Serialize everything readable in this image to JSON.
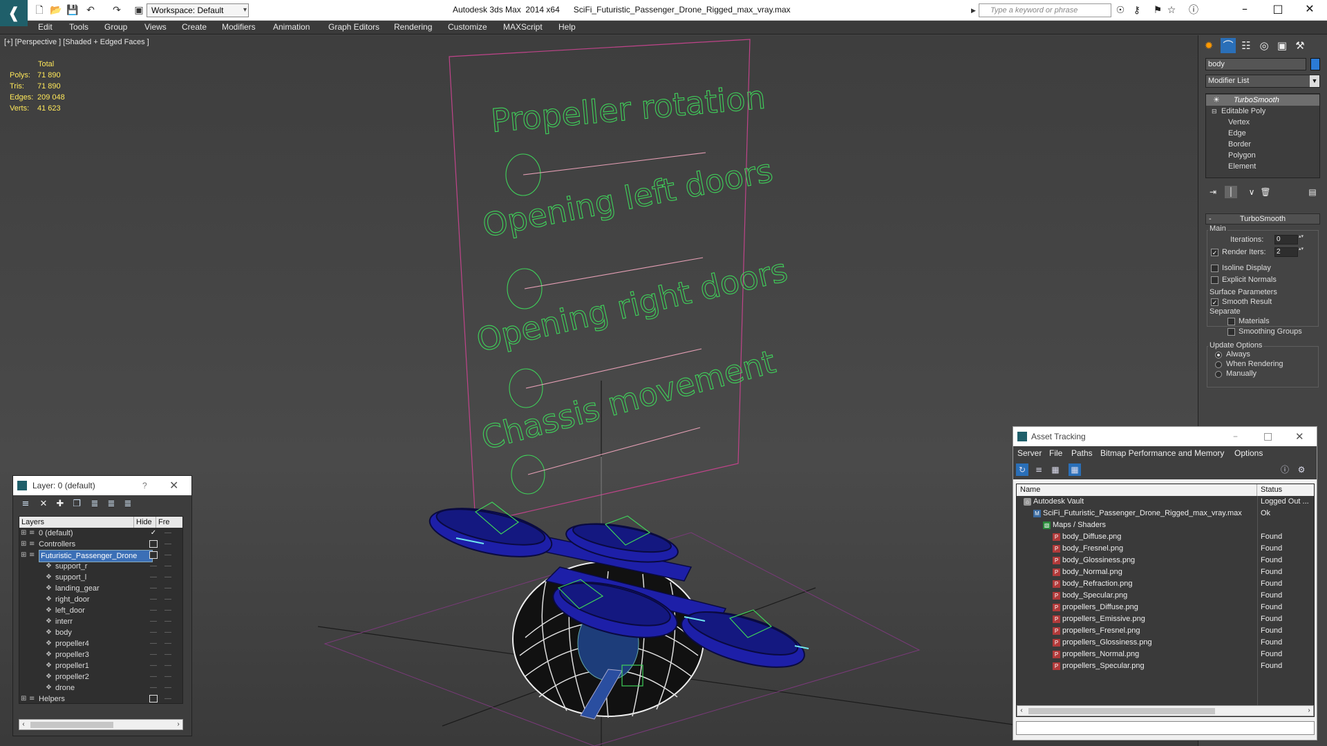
{
  "titlebar": {
    "workspace": "Workspace: Default",
    "title": "Autodesk 3ds Max  2014 x64      SciFi_Futuristic_Passenger_Drone_Rigged_max_vray.max",
    "search_placeholder": "Type a keyword or phrase"
  },
  "menu": [
    "Edit",
    "Tools",
    "Group",
    "Views",
    "Create",
    "Modifiers",
    "Animation",
    "Graph Editors",
    "Rendering",
    "Customize",
    "MAXScript",
    "Help"
  ],
  "viewport": {
    "label": "[+] [Perspective ] [Shaded + Edged Faces ]",
    "stats": {
      "header": "Total",
      "rows": [
        {
          "label": "Polys:",
          "value": "71 890"
        },
        {
          "label": "Tris:",
          "value": "71 890"
        },
        {
          "label": "Edges:",
          "value": "209 048"
        },
        {
          "label": "Verts:",
          "value": "41 623"
        }
      ]
    },
    "controls": [
      "Propeller rotation",
      "Opening left doors",
      "Opening right doors",
      "Chassis movement"
    ]
  },
  "layer_window": {
    "title": "Layer: 0 (default)",
    "help": "?",
    "columns": [
      "Layers",
      "Hide",
      "Fre"
    ],
    "rows": [
      {
        "name": "0 (default)",
        "indent": 0,
        "kind": "layer",
        "hide": "check"
      },
      {
        "name": "Controllers",
        "indent": 0,
        "kind": "layer",
        "hide": "box"
      },
      {
        "name": "Futuristic_Passenger_Drone",
        "indent": 0,
        "kind": "layer",
        "hide": "box",
        "selected": true
      },
      {
        "name": "support_r",
        "indent": 1,
        "kind": "object",
        "hide": "dash"
      },
      {
        "name": "support_l",
        "indent": 1,
        "kind": "object",
        "hide": "dash"
      },
      {
        "name": "landing_gear",
        "indent": 1,
        "kind": "object",
        "hide": "dash"
      },
      {
        "name": "right_door",
        "indent": 1,
        "kind": "object",
        "hide": "dash"
      },
      {
        "name": "left_door",
        "indent": 1,
        "kind": "object",
        "hide": "dash"
      },
      {
        "name": "interr",
        "indent": 1,
        "kind": "object",
        "hide": "dash"
      },
      {
        "name": "body",
        "indent": 1,
        "kind": "object",
        "hide": "dash"
      },
      {
        "name": "propeller4",
        "indent": 1,
        "kind": "object",
        "hide": "dash"
      },
      {
        "name": "propeller3",
        "indent": 1,
        "kind": "object",
        "hide": "dash"
      },
      {
        "name": "propeller1",
        "indent": 1,
        "kind": "object",
        "hide": "dash"
      },
      {
        "name": "propeller2",
        "indent": 1,
        "kind": "object",
        "hide": "dash"
      },
      {
        "name": "drone",
        "indent": 1,
        "kind": "object",
        "hide": "dash"
      },
      {
        "name": "Helpers",
        "indent": 0,
        "kind": "layer",
        "hide": "box"
      }
    ]
  },
  "command_panel": {
    "object_name": "body",
    "object_color": "#2b7bd6",
    "modifier_list": "Modifier List",
    "stack": [
      "TurboSmooth",
      "Editable Poly",
      "Vertex",
      "Edge",
      "Border",
      "Polygon",
      "Element"
    ],
    "rollout_title": "TurboSmooth",
    "main_label": "Main",
    "iterations_label": "Iterations:",
    "iterations_value": "0",
    "render_iters_label": "Render Iters:",
    "render_iters_value": "2",
    "isoline": "Isoline Display",
    "explicit_normals": "Explicit Normals",
    "surface_params": "Surface Parameters",
    "smooth_result": "Smooth Result",
    "separate": "Separate",
    "materials": "Materials",
    "smoothing_groups": "Smoothing Groups",
    "update_options": "Update Options",
    "always": "Always",
    "when_rendering": "When Rendering",
    "manually": "Manually"
  },
  "asset_tracking": {
    "title": "Asset Tracking",
    "menu": [
      "Server",
      "File",
      "Paths",
      "Bitmap Performance and Memory",
      "Options"
    ],
    "columns": [
      "Name",
      "Status"
    ],
    "rows": [
      {
        "name": "Autodesk Vault",
        "status": "Logged Out ...",
        "indent": 0,
        "icon": "vault"
      },
      {
        "name": "SciFi_Futuristic_Passenger_Drone_Rigged_max_vray.max",
        "status": "Ok",
        "indent": 1,
        "icon": "max"
      },
      {
        "name": "Maps / Shaders",
        "status": "",
        "indent": 2,
        "icon": "map"
      },
      {
        "name": "body_Diffuse.png",
        "status": "Found",
        "indent": 3,
        "icon": "png"
      },
      {
        "name": "body_Fresnel.png",
        "status": "Found",
        "indent": 3,
        "icon": "png"
      },
      {
        "name": "body_Glossiness.png",
        "status": "Found",
        "indent": 3,
        "icon": "png"
      },
      {
        "name": "body_Normal.png",
        "status": "Found",
        "indent": 3,
        "icon": "png"
      },
      {
        "name": "body_Refraction.png",
        "status": "Found",
        "indent": 3,
        "icon": "png"
      },
      {
        "name": "body_Specular.png",
        "status": "Found",
        "indent": 3,
        "icon": "png"
      },
      {
        "name": "propellers_Diffuse.png",
        "status": "Found",
        "indent": 3,
        "icon": "png"
      },
      {
        "name": "propellers_Emissive.png",
        "status": "Found",
        "indent": 3,
        "icon": "png"
      },
      {
        "name": "propellers_Fresnel.png",
        "status": "Found",
        "indent": 3,
        "icon": "png"
      },
      {
        "name": "propellers_Glossiness.png",
        "status": "Found",
        "indent": 3,
        "icon": "png"
      },
      {
        "name": "propellers_Normal.png",
        "status": "Found",
        "indent": 3,
        "icon": "png"
      },
      {
        "name": "propellers_Specular.png",
        "status": "Found",
        "indent": 3,
        "icon": "png"
      }
    ]
  },
  "colors": {
    "wire_green": "#3fd25a",
    "board_magenta": "#c0448a",
    "drone_blue": "#1d1fa8"
  }
}
